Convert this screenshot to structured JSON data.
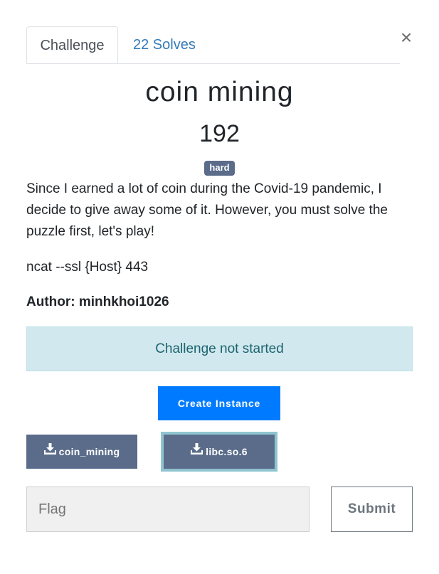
{
  "tabs": {
    "challenge_label": "Challenge",
    "solves_label": "22 Solves"
  },
  "close_glyph": "×",
  "challenge": {
    "name": "coin mining",
    "points": "192",
    "difficulty_badge": "hard",
    "description": "Since I earned a lot of coin during the Covid-19 pandemic, I decide to give away some of it. However, you must solve the puzzle first, let's play!",
    "connection": "ncat --ssl {Host} 443",
    "author": "Author: minhkhoi1026"
  },
  "instance": {
    "status": "Challenge not started",
    "create_label": "Create Instance"
  },
  "files": [
    {
      "label": "coin_mining"
    },
    {
      "label": "libc.so.6"
    }
  ],
  "flag_form": {
    "placeholder": "Flag",
    "value": "",
    "submit_label": "Submit"
  },
  "colors": {
    "badge": "#5a6c8a",
    "primary": "#007bff",
    "info_bg": "#d1e9ee",
    "info_text": "#1d6470",
    "link": "#337ab7"
  },
  "icons": {
    "download": "download-icon",
    "close": "close-icon"
  }
}
